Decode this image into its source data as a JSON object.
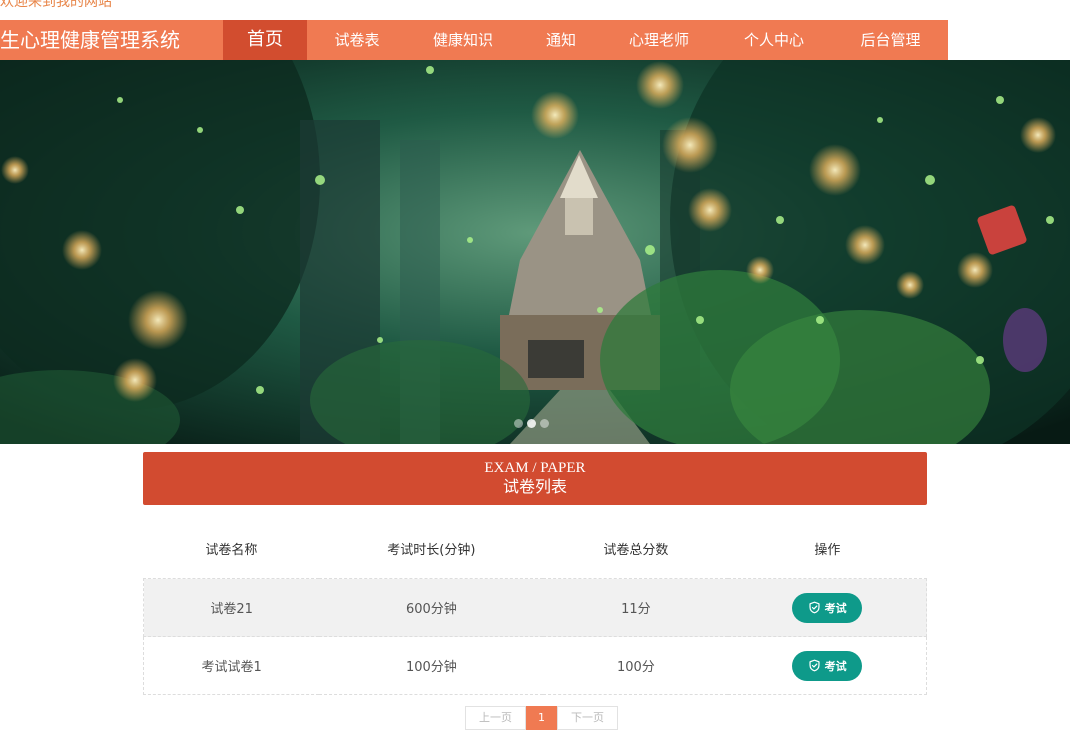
{
  "welcome": "欢迎来到我的网站",
  "brand": "生心理健康管理系统",
  "nav": [
    {
      "label": "首页",
      "active": true,
      "name": "nav-home"
    },
    {
      "label": "试卷表",
      "active": false,
      "name": "nav-papers"
    },
    {
      "label": "健康知识",
      "active": false,
      "name": "nav-health-knowledge"
    },
    {
      "label": "通知",
      "active": false,
      "name": "nav-notices"
    },
    {
      "label": "心理老师",
      "active": false,
      "name": "nav-teachers"
    },
    {
      "label": "个人中心",
      "active": false,
      "name": "nav-profile"
    },
    {
      "label": "后台管理",
      "active": false,
      "name": "nav-admin"
    }
  ],
  "carousel": {
    "dots": 3,
    "active_index": 1
  },
  "section": {
    "title_en": "EXAM / PAPER",
    "title_cn": "试卷列表"
  },
  "table": {
    "headers": [
      "试卷名称",
      "考试时长(分钟)",
      "试卷总分数",
      "操作"
    ],
    "rows": [
      {
        "name": "试卷21",
        "duration": "600分钟",
        "score": "11分",
        "action": "考试"
      },
      {
        "name": "考试试卷1",
        "duration": "100分钟",
        "score": "100分",
        "action": "考试"
      }
    ]
  },
  "pagination": {
    "prev": "上一页",
    "current": "1",
    "next": "下一页"
  },
  "colors": {
    "nav_bg": "#f07a52",
    "nav_active": "#d24d2f",
    "section_header": "#d24b30",
    "exam_button": "#0e9a8a"
  },
  "icons": {
    "exam_button_icon": "shield-check-icon"
  }
}
